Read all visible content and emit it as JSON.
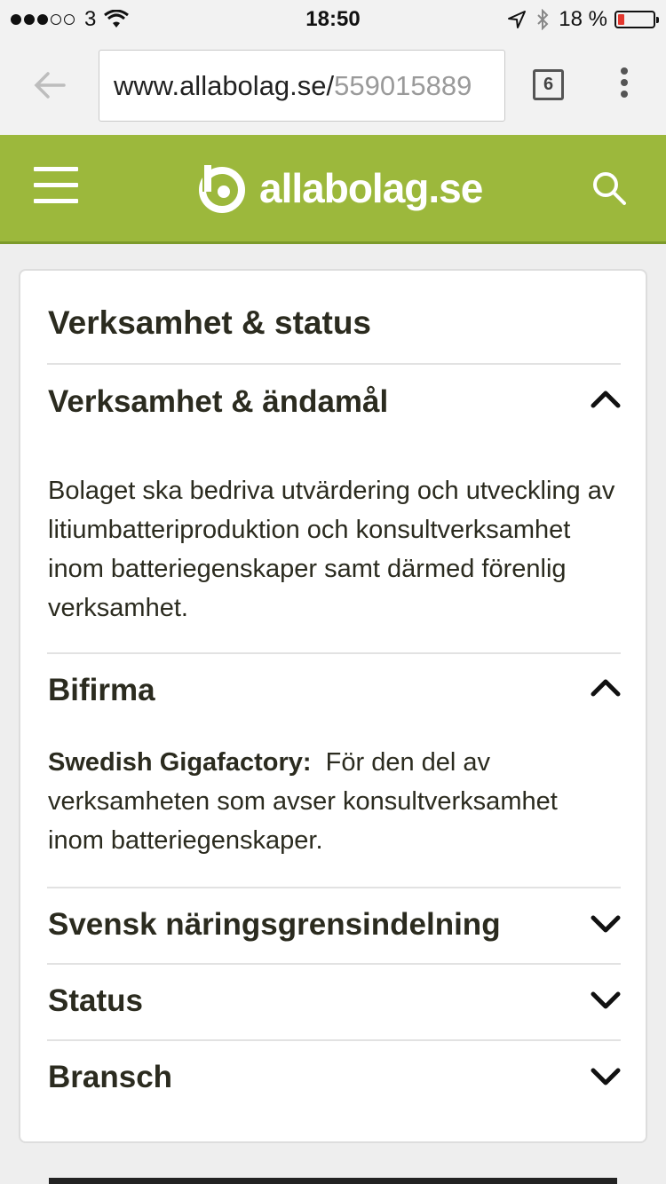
{
  "status_bar": {
    "carrier": "3",
    "time": "18:50",
    "battery_percent": "18 %",
    "battery_level": 0.18
  },
  "browser": {
    "url_host": "www.allabolag.se/",
    "url_path": "559015889",
    "tab_count": "6"
  },
  "site": {
    "logo_text": "allabolag.se",
    "brand_color": "#9cb83c"
  },
  "card": {
    "title": "Verksamhet & status",
    "sections": [
      {
        "heading": "Verksamhet & ändamål",
        "expanded": true,
        "text": "Bolaget ska bedriva utvärdering och utveckling av litiumbatteriproduktion och konsultverksamhet inom batteriegenskaper samt därmed förenlig verksamhet."
      },
      {
        "heading": "Bifirma",
        "expanded": true,
        "name": "Swedish Gigafactory:",
        "text": "För den del av verksamheten som avser konsultverksamhet inom batteriegenskaper."
      },
      {
        "heading": "Svensk näringsgrensindelning",
        "expanded": false
      },
      {
        "heading": "Status",
        "expanded": false
      },
      {
        "heading": "Bransch",
        "expanded": false
      }
    ]
  }
}
